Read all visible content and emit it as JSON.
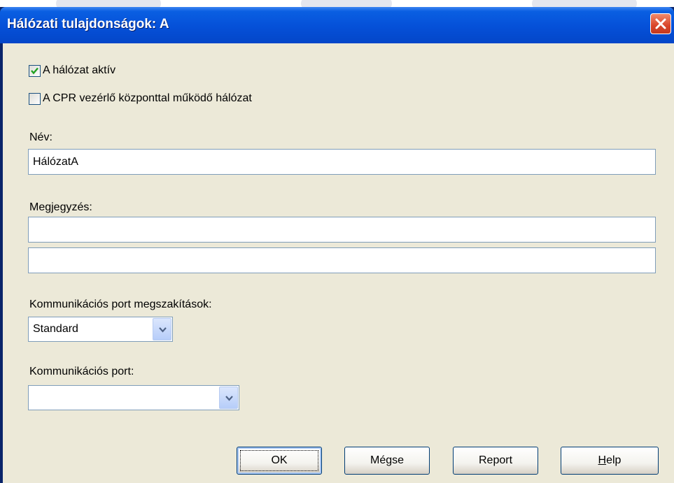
{
  "window": {
    "title": "Hálózati tulajdonságok: A"
  },
  "options": {
    "active": {
      "label": "A hálózat aktív",
      "checked": true
    },
    "cpr": {
      "label": "A CPR vezérlő központtal működő hálózat",
      "checked": false
    }
  },
  "name": {
    "label": "Név:",
    "value": "HálózatA"
  },
  "note": {
    "label": "Megjegyzés:",
    "line1": "",
    "line2": ""
  },
  "interrupts": {
    "label": "Kommunikációs port megszakítások:",
    "selected": "Standard"
  },
  "port": {
    "label": "Kommunikációs port:",
    "selected": ""
  },
  "buttons": {
    "ok": "OK",
    "cancel": "Mégse",
    "report": "Report",
    "help": "Help"
  },
  "colors": {
    "titlebar": "#0550d8",
    "client_bg": "#ece9d8",
    "close": "#d9452a",
    "input_border": "#7f9db9"
  },
  "icons": {
    "close": "close-icon",
    "check": "checkmark-icon",
    "dropdown": "chevron-down-icon"
  }
}
